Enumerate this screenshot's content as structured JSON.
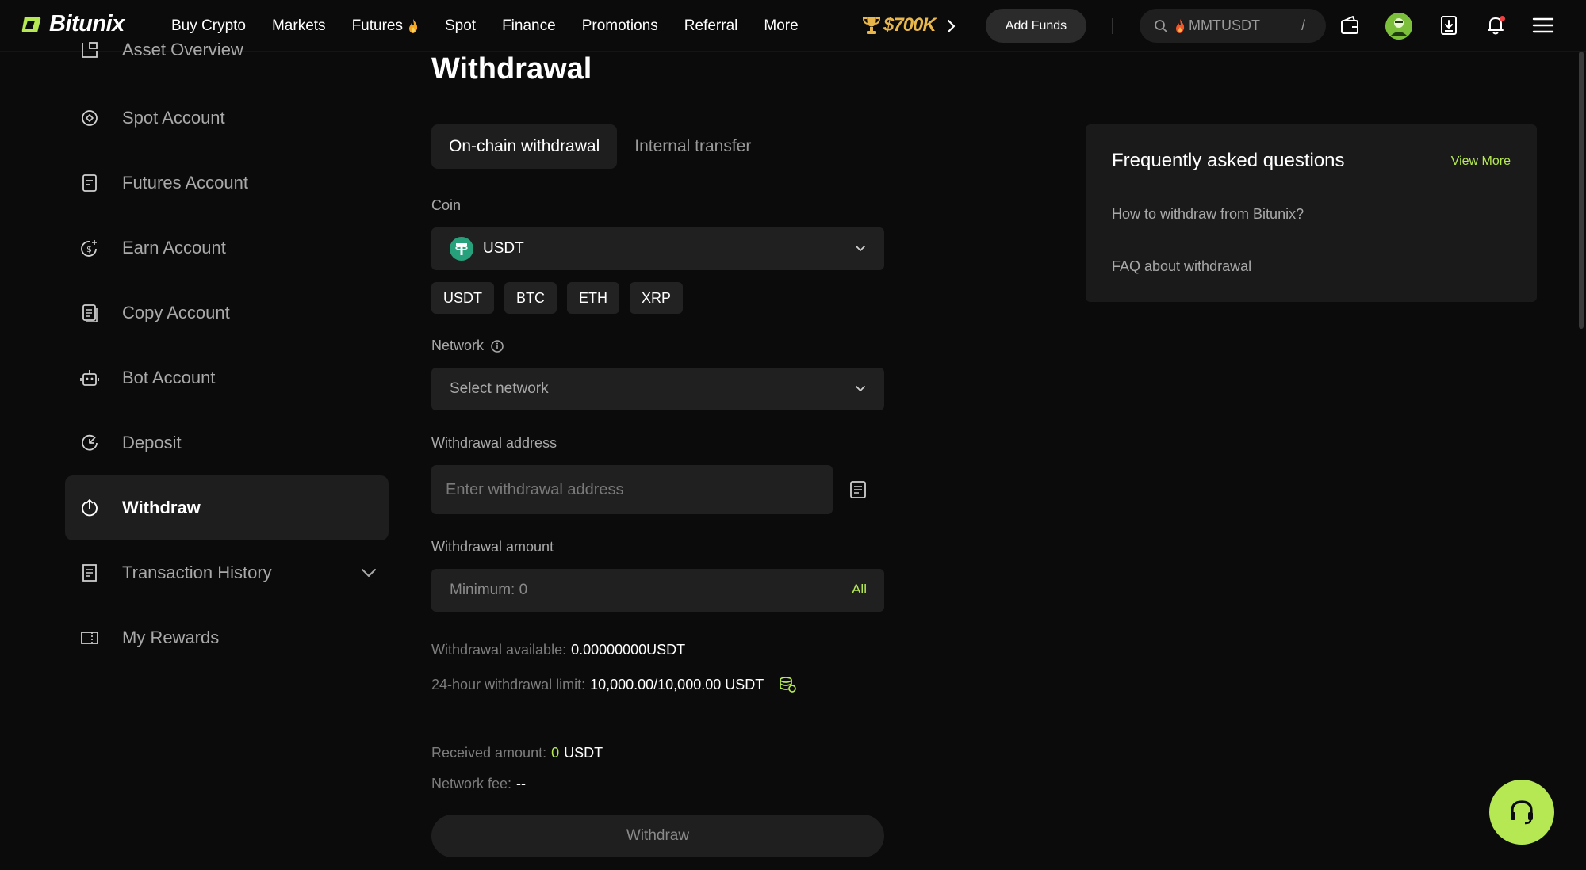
{
  "brand": {
    "name": "Bitunix",
    "accent": "#b5e853"
  },
  "topnav": {
    "links": [
      {
        "label": "Buy Crypto"
      },
      {
        "label": "Markets"
      },
      {
        "label": "Futures"
      },
      {
        "label": "Spot"
      },
      {
        "label": "Finance"
      },
      {
        "label": "Promotions"
      },
      {
        "label": "Referral"
      },
      {
        "label": "More"
      }
    ],
    "promo_text": "$700K",
    "add_funds_label": "Add Funds",
    "search_text": "MMTUSDT",
    "search_shortcut": "/"
  },
  "sidebar": {
    "items": [
      {
        "label": "Asset Overview"
      },
      {
        "label": "Spot Account"
      },
      {
        "label": "Futures Account"
      },
      {
        "label": "Earn Account"
      },
      {
        "label": "Copy Account"
      },
      {
        "label": "Bot Account"
      },
      {
        "label": "Deposit"
      },
      {
        "label": "Withdraw",
        "active": true
      },
      {
        "label": "Transaction History"
      },
      {
        "label": "My Rewards"
      }
    ]
  },
  "main": {
    "title": "Withdrawal",
    "tabs": [
      {
        "label": "On-chain withdrawal",
        "active": true
      },
      {
        "label": "Internal transfer"
      }
    ],
    "coin_label": "Coin",
    "coin_selected": "USDT",
    "coin_chips": [
      "USDT",
      "BTC",
      "ETH",
      "XRP"
    ],
    "network_label": "Network",
    "network_placeholder": "Select network",
    "address_label": "Withdrawal address",
    "address_placeholder": "Enter withdrawal address",
    "amount_label": "Withdrawal amount",
    "amount_placeholder": "Minimum: 0",
    "all_label": "All",
    "available_label": "Withdrawal available:",
    "available_value": "0.00000000USDT",
    "limit_label": "24-hour withdrawal limit:",
    "limit_value": "10,000.00/10,000.00 USDT",
    "received_label": "Received amount:",
    "received_value": "0",
    "received_unit": "USDT",
    "fee_label": "Network fee:",
    "fee_value": "--",
    "withdraw_button": "Withdraw"
  },
  "faq": {
    "title": "Frequently asked questions",
    "view_more": "View More",
    "items": [
      {
        "label": "How to withdraw from Bitunix?"
      },
      {
        "label": "FAQ about withdrawal"
      }
    ]
  }
}
